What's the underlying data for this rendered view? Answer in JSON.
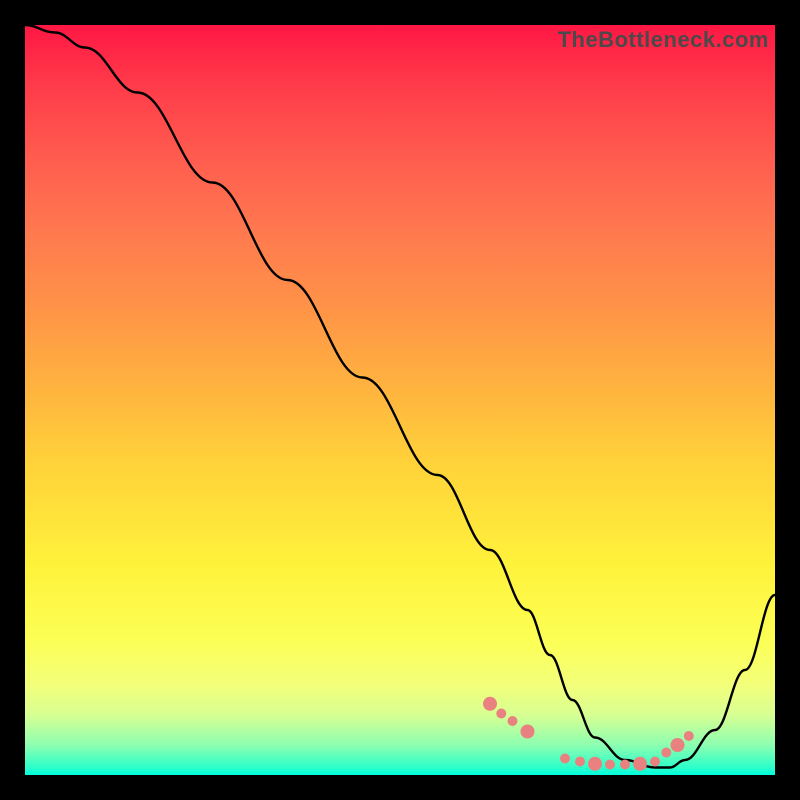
{
  "watermark": "TheBottleneck.com",
  "chart_data": {
    "type": "line",
    "title": "",
    "xlabel": "",
    "ylabel": "",
    "xlim": [
      0,
      100
    ],
    "ylim": [
      0,
      100
    ],
    "grid": false,
    "legend": false,
    "series": [
      {
        "name": "bottleneck-curve",
        "x": [
          0,
          4,
          8,
          15,
          25,
          35,
          45,
          55,
          62,
          67,
          70,
          73,
          76,
          80,
          84,
          86,
          88,
          92,
          96,
          100
        ],
        "values": [
          100,
          99,
          97,
          91,
          79,
          66,
          53,
          40,
          30,
          22,
          16,
          10,
          5,
          2,
          1,
          1,
          2,
          6,
          14,
          24
        ]
      }
    ],
    "markers": {
      "comment": "dotted pink segments near the trough",
      "color": "#e8817f",
      "points_x": [
        62,
        63.5,
        65,
        67,
        72,
        74,
        76,
        78,
        80,
        82,
        84,
        85.5,
        87,
        88.5
      ],
      "points_y": [
        9.5,
        8.2,
        7.2,
        5.8,
        2.2,
        1.8,
        1.5,
        1.4,
        1.4,
        1.5,
        1.8,
        3.0,
        4.0,
        5.2
      ]
    }
  }
}
